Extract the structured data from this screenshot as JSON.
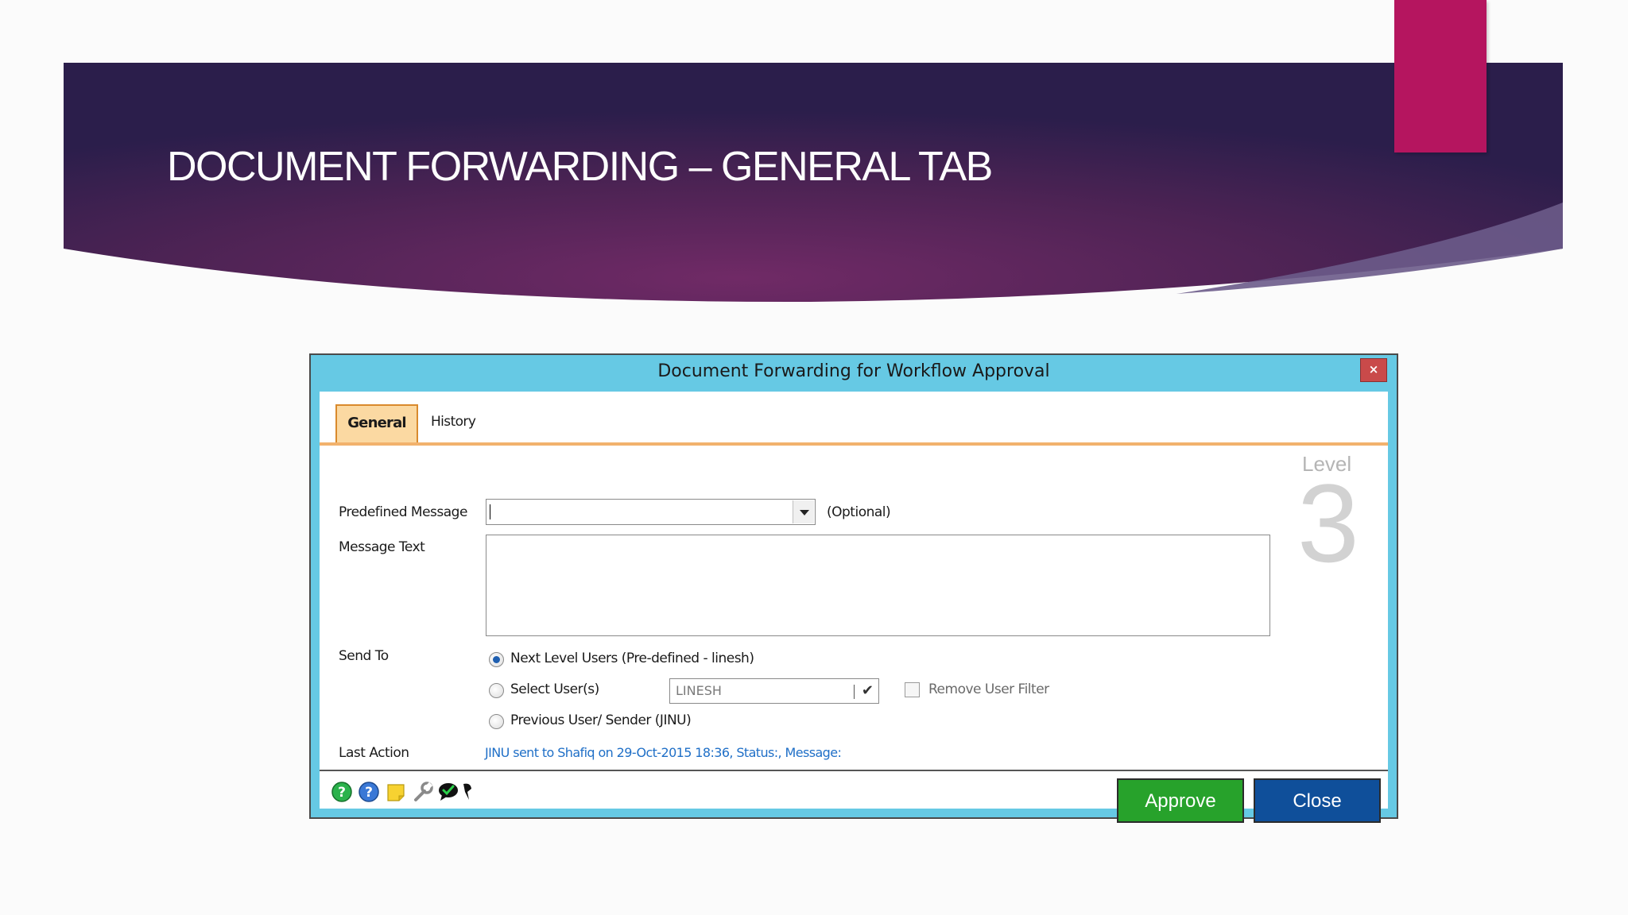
{
  "slide": {
    "title": "DOCUMENT  FORWARDING – GENERAL TAB"
  },
  "dialog": {
    "title": "Document Forwarding for Workflow Approval",
    "close_label": "×",
    "tabs": [
      {
        "label": "General",
        "active": true
      },
      {
        "label": "History",
        "active": false
      }
    ],
    "predefined_message": {
      "label": "Predefined Message",
      "value": "",
      "hint": "(Optional)"
    },
    "message_text": {
      "label": "Message Text",
      "value": ""
    },
    "send_to": {
      "label": "Send To",
      "options": [
        {
          "label": "Next Level Users (Pre-defined - linesh)",
          "selected": true
        },
        {
          "label": "Select User(s)",
          "selected": false
        },
        {
          "label": "Previous User/ Sender (JINU)",
          "selected": false
        }
      ],
      "user_select_value": "LINESH",
      "remove_filter_label": "Remove User Filter",
      "remove_filter_checked": false
    },
    "last_action": {
      "label": "Last Action",
      "value": "JINU sent to Shafiq on 29-Oct-2015 18:36, Status:, Message:"
    },
    "level": {
      "label": "Level",
      "value": "3"
    },
    "toolbar_icons": [
      "help-green-icon",
      "help-blue-icon",
      "note-icon",
      "wrench-icon",
      "chat-check-icon",
      "pin-icon"
    ],
    "buttons": {
      "approve": "Approve",
      "close": "Close"
    }
  },
  "colors": {
    "banner_dark": "#2d1f4e",
    "banner_mid": "#6b2a63",
    "accent_pink": "#b5155f",
    "dialog_frame": "#66c9e4",
    "tab_active": "#fbd9a2",
    "approve": "#27a22b",
    "close": "#0f4f9a",
    "link_blue": "#1f6fc7"
  }
}
